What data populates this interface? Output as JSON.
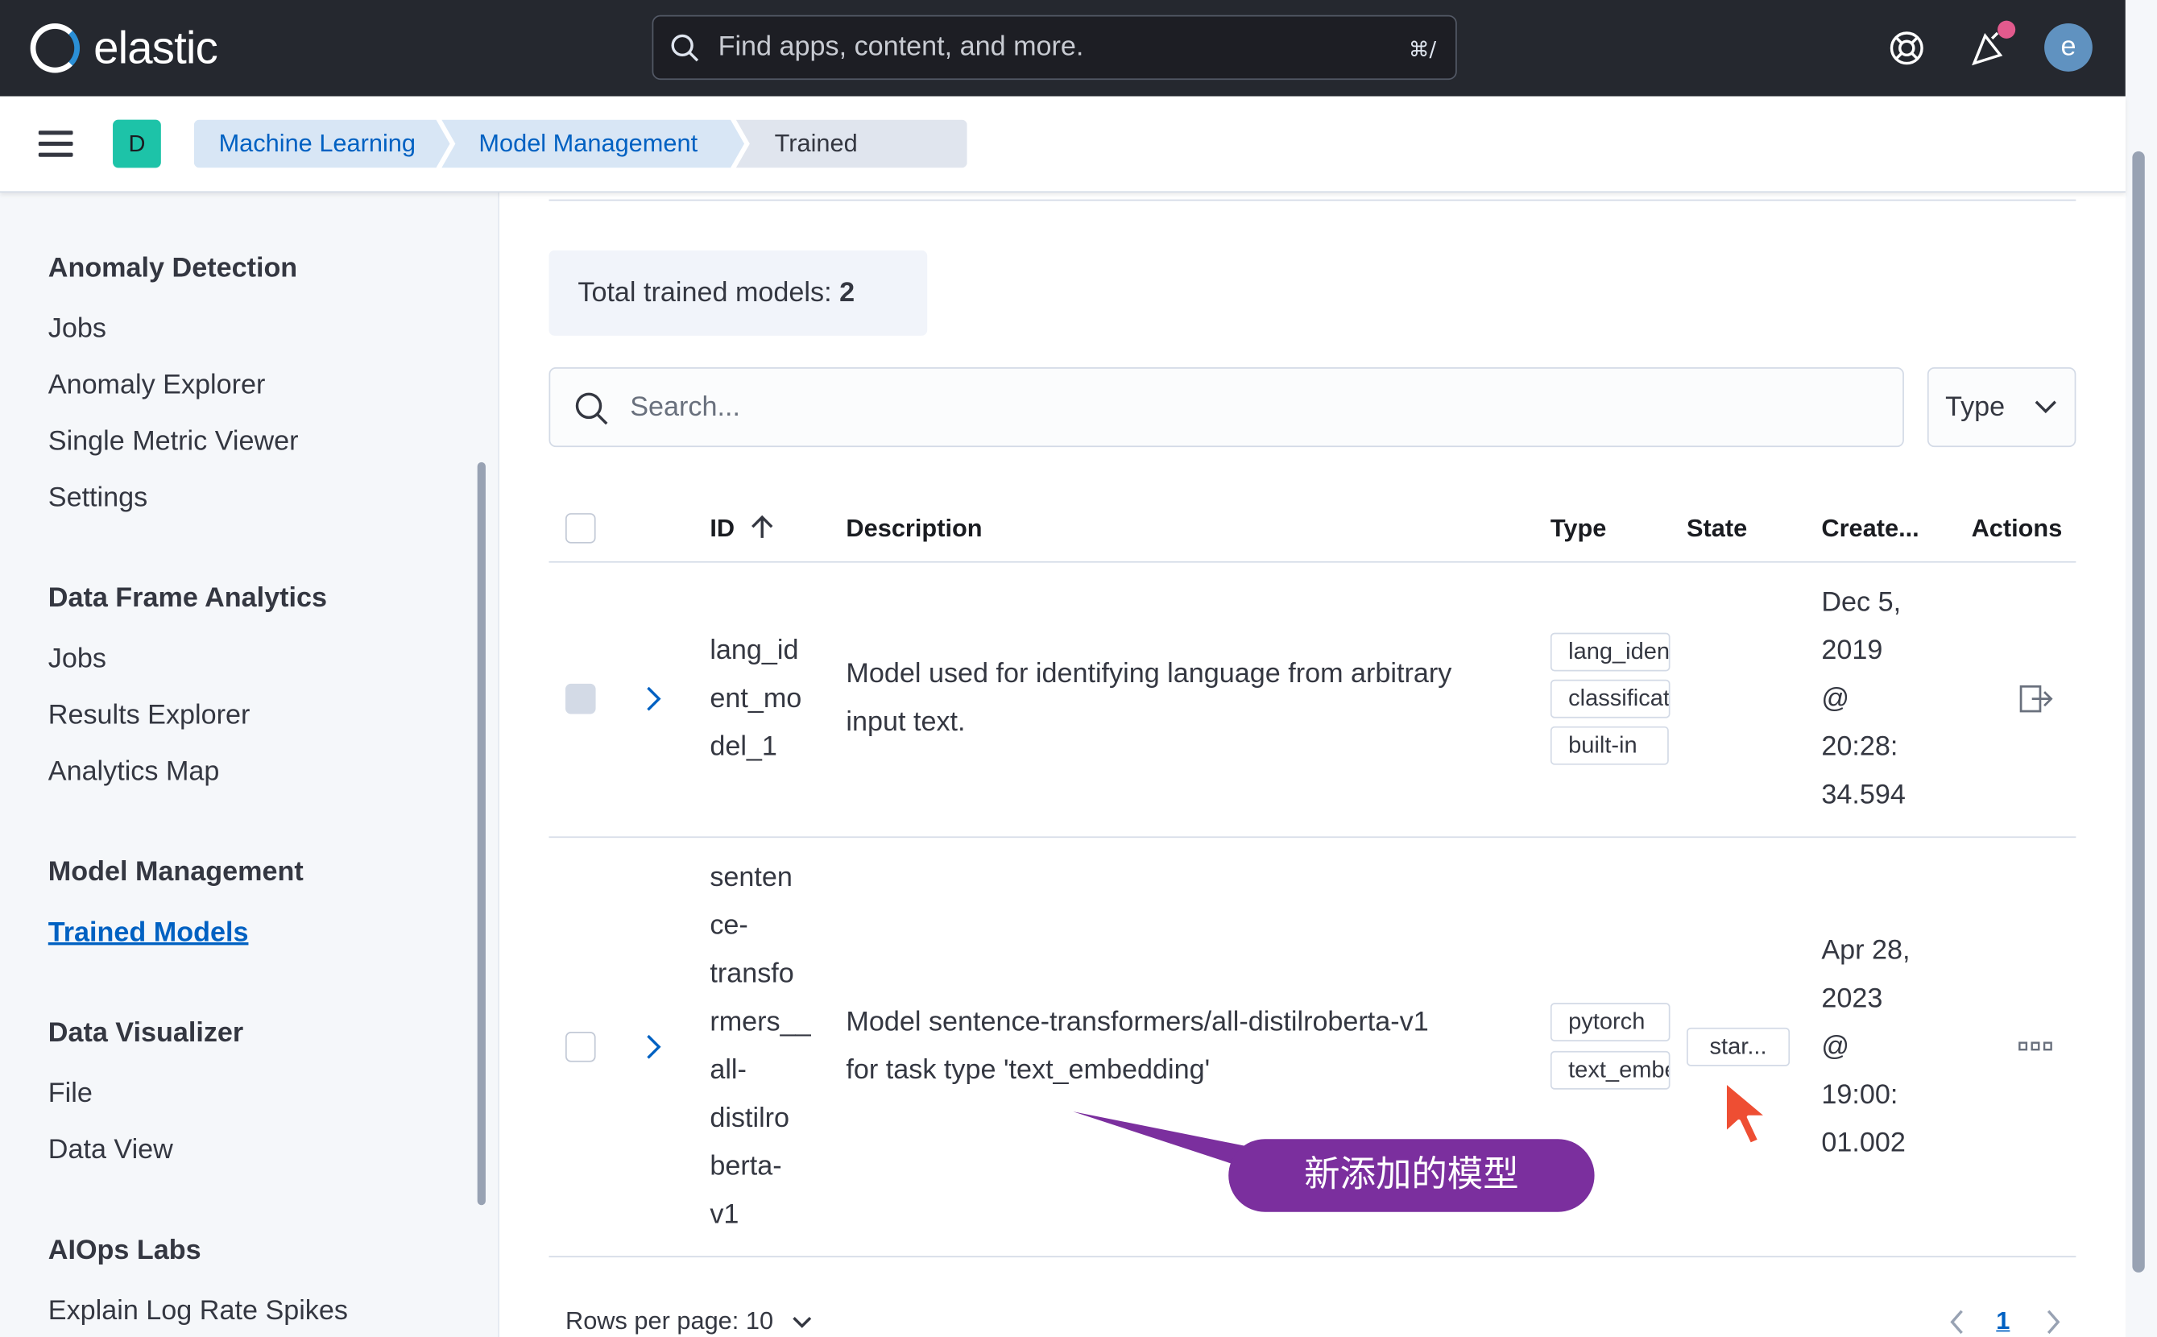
{
  "header": {
    "logo_text": "elastic",
    "search_placeholder": "Find apps, content, and more.",
    "search_shortcut": "⌘/",
    "avatar_initial": "e"
  },
  "subheader": {
    "space_initial": "D",
    "breadcrumbs": [
      "Machine Learning",
      "Model Management",
      "Trained Models"
    ]
  },
  "sidebar": {
    "sections": [
      {
        "title": "Anomaly Detection",
        "items": [
          "Jobs",
          "Anomaly Explorer",
          "Single Metric Viewer",
          "Settings"
        ]
      },
      {
        "title": "Data Frame Analytics",
        "items": [
          "Jobs",
          "Results Explorer",
          "Analytics Map"
        ]
      },
      {
        "title": "Model Management",
        "items": [
          "Trained Models"
        ]
      },
      {
        "title": "Data Visualizer",
        "items": [
          "File",
          "Data View"
        ]
      },
      {
        "title": "AIOps Labs",
        "items": [
          "Explain Log Rate Spikes"
        ]
      }
    ]
  },
  "main": {
    "total_label": "Total trained models: ",
    "total_count": "2",
    "search_placeholder": "Search...",
    "type_filter": "Type",
    "columns": [
      "ID",
      "Description",
      "Type",
      "State",
      "Create...",
      "Actions"
    ],
    "rows": [
      {
        "id_lines": [
          "lang_id",
          "ent_mo",
          "del_1"
        ],
        "description_lines": [
          "Model used for identifying language from arbitrary",
          "input text."
        ],
        "types": [
          "lang_ident",
          "classification",
          "built-in"
        ],
        "state": "",
        "created_lines": [
          "Dec 5,",
          "2019",
          "@",
          "20:28:",
          "34.594"
        ]
      },
      {
        "id_lines": [
          "senten",
          "ce-",
          "transfo",
          "rmers__",
          "all-",
          "distilro",
          "berta-",
          "v1"
        ],
        "description_lines": [
          "Model sentence-transformers/all-distilroberta-v1",
          "for task type 'text_embedding'"
        ],
        "types": [
          "pytorch",
          "text_embedding"
        ],
        "state": "star...",
        "created_lines": [
          "Apr 28,",
          "2023",
          "@",
          "19:00:",
          "01.002"
        ]
      }
    ],
    "rows_per_page": "Rows per page: 10",
    "current_page": "1"
  },
  "annotation": {
    "callout_text": "新添加的模型"
  }
}
